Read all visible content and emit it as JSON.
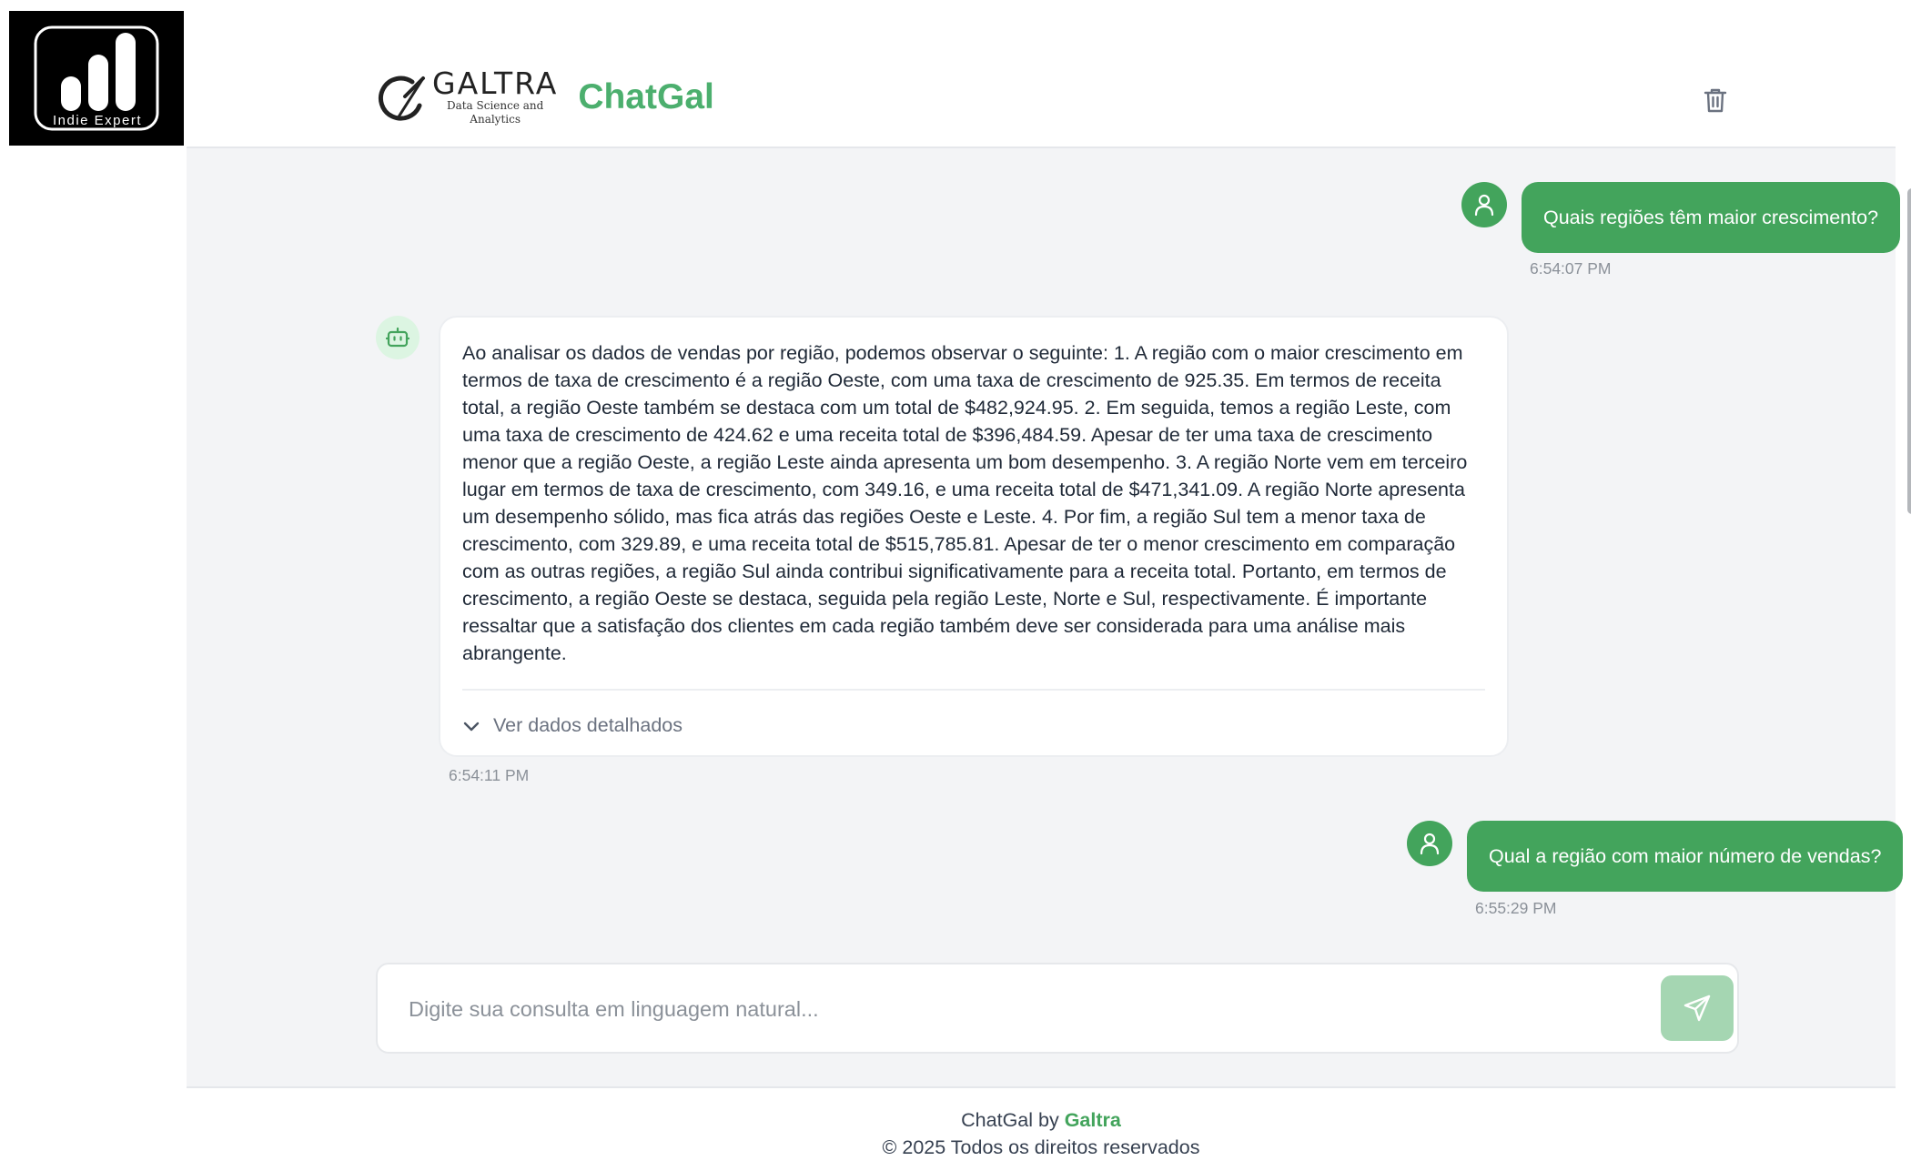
{
  "corner_logo": {
    "text": "Indie Expert"
  },
  "header": {
    "galtra_name": "GALTRA",
    "galtra_sub_1": "Data Science and",
    "galtra_sub_2": "Analytics",
    "title": "ChatGal",
    "clear_icon": "trash-icon"
  },
  "messages": [
    {
      "role": "user",
      "text": "Quais regiões têm maior crescimento?",
      "time": "6:54:07 PM"
    },
    {
      "role": "assistant",
      "text": "Ao analisar os dados de vendas por região, podemos observar o seguinte: 1. A região com o maior crescimento em termos de taxa de crescimento é a região Oeste, com uma taxa de crescimento de 925.35. Em termos de receita total, a região Oeste também se destaca com um total de $482,924.95. 2. Em seguida, temos a região Leste, com uma taxa de crescimento de 424.62 e uma receita total de $396,484.59. Apesar de ter uma taxa de crescimento menor que a região Oeste, a região Leste ainda apresenta um bom desempenho. 3. A região Norte vem em terceiro lugar em termos de taxa de crescimento, com 349.16, e uma receita total de $471,341.09. A região Norte apresenta um desempenho sólido, mas fica atrás das regiões Oeste e Leste. 4. Por fim, a região Sul tem a menor taxa de crescimento, com 329.89, e uma receita total de $515,785.81. Apesar de ter o menor crescimento em comparação com as outras regiões, a região Sul ainda contribui significativamente para a receita total. Portanto, em termos de crescimento, a região Oeste se destaca, seguida pela região Leste, Norte e Sul, respectivamente. É importante ressaltar que a satisfação dos clientes em cada região também deve ser considerada para uma análise mais abrangente.",
      "details_label": "Ver dados detalhados",
      "time": "6:54:11 PM"
    },
    {
      "role": "user",
      "text": "Qual a região com maior número de vendas?",
      "time": "6:55:29 PM"
    }
  ],
  "composer": {
    "placeholder": "Digite sua consulta em linguagem natural...",
    "send_icon": "send-icon"
  },
  "footer": {
    "line1_prefix": "ChatGal by ",
    "line1_brand": "Galtra",
    "line2": "© 2025 Todos os direitos reservados"
  },
  "colors": {
    "accent": "#43a45c",
    "title_green": "#4caf6e",
    "send_disabled": "#a5d6b2",
    "chat_bg": "#f3f4f6"
  }
}
